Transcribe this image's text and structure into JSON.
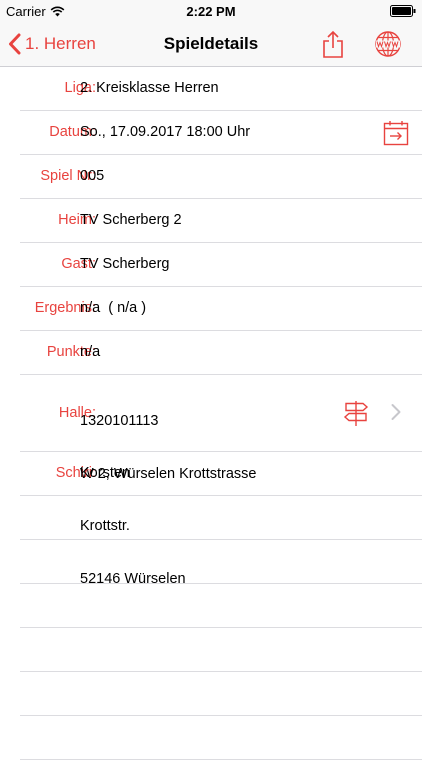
{
  "status_bar": {
    "carrier": "Carrier",
    "time": "2:22 PM"
  },
  "nav": {
    "back_label": "1. Herren",
    "title": "Spieldetails"
  },
  "fields": [
    {
      "label": "Liga:",
      "value": "2. Kreisklasse Herren"
    },
    {
      "label": "Datum:",
      "value": "So., 17.09.2017 18:00 Uhr"
    },
    {
      "label": "Spiel Nr:",
      "value": "005"
    },
    {
      "label": "Heim:",
      "value": "TV Scherberg 2"
    },
    {
      "label": "Gast:",
      "value": "TV Scherberg"
    },
    {
      "label": "Ergebnis:",
      "value": "n/a  ( n/a )"
    },
    {
      "label": "Punkte:",
      "value": "n/a"
    },
    {
      "label": "Halle:",
      "lines": [
        "1320101113",
        "W 2, Würselen Krottstrasse",
        "Krottstr.",
        "52146 Würselen"
      ]
    },
    {
      "label": "Schiri:",
      "value": "Korsten"
    }
  ],
  "colors": {
    "accent": "#e8433f",
    "separator": "#dcdce0",
    "nav_bg": "#f8f8f8"
  },
  "icons": {
    "back": "chevron-left-icon",
    "share": "share-icon",
    "web": "www-globe-icon",
    "calendar": "calendar-export-icon",
    "directions": "signpost-icon",
    "disclosure": "chevron-right-icon"
  }
}
